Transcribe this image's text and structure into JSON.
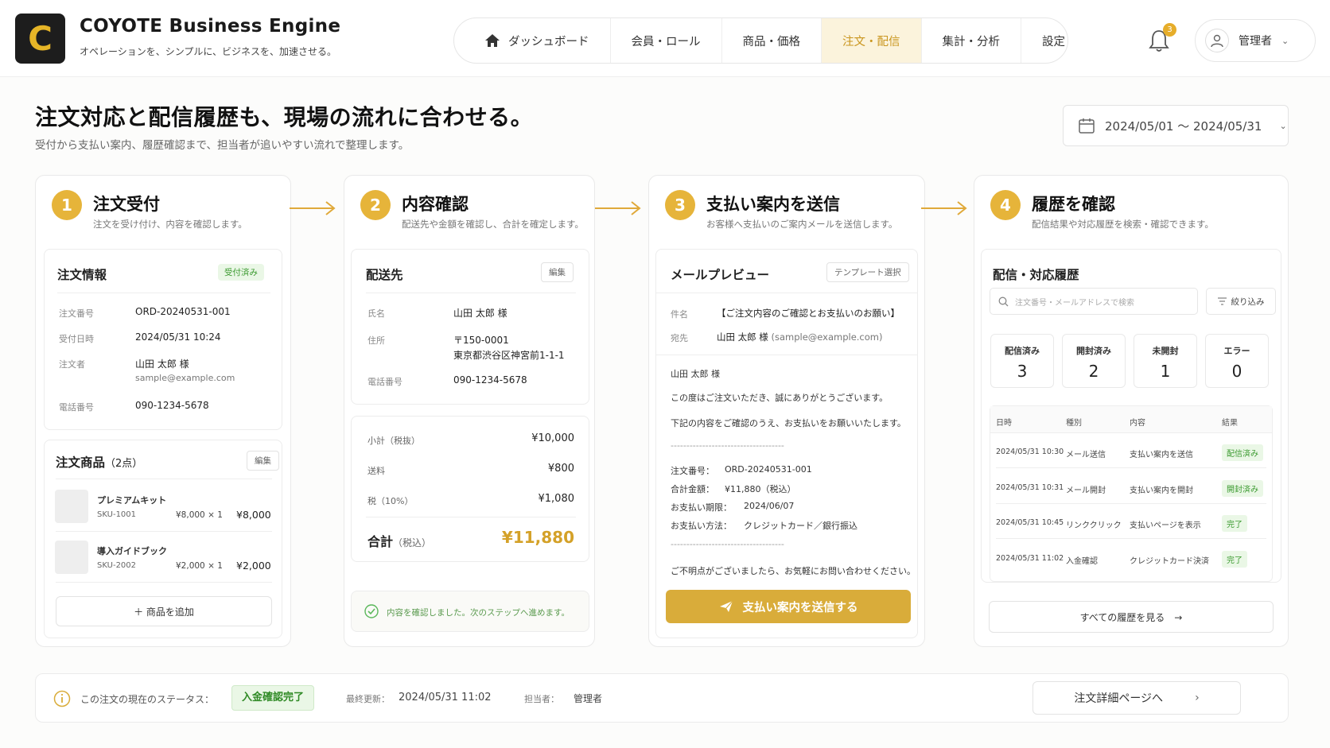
{
  "app": {
    "logo_letter": "C",
    "title": "COYOTE Business Engine",
    "tagline": "オペレーションを、シンプルに、ビジネスを、加速させる。"
  },
  "nav": [
    {
      "label": "ダッシュボード",
      "icon": "home-icon"
    },
    {
      "label": "会員・ロール"
    },
    {
      "label": "商品・価格"
    },
    {
      "label": "注文・配信",
      "active": true
    },
    {
      "label": "集計・分析"
    },
    {
      "label": "設定"
    }
  ],
  "notifications": {
    "count": "3"
  },
  "user": {
    "name": "管理者"
  },
  "page": {
    "title": "注文対応と配信履歴も、現場の流れに合わせる。",
    "subtitle": "受付から支払い案内、履歴確認まで、担当者が追いやすい流れで整理します。",
    "date_range": "2024/05/01 〜 2024/05/31"
  },
  "steps": [
    {
      "num": "1",
      "title": "注文受付",
      "desc": "注文を受け付け、内容を確認します。"
    },
    {
      "num": "2",
      "title": "内容確認",
      "desc": "配送先や金額を確認し、合計を確定します。"
    },
    {
      "num": "3",
      "title": "支払い案内を送信",
      "desc": "お客様へ支払いのご案内メールを送信します。"
    },
    {
      "num": "4",
      "title": "履歴を確認",
      "desc": "配信結果や対応履歴を検索・確認できます。"
    }
  ],
  "order_info": {
    "title": "注文情報",
    "status": "受付済み",
    "order_no_label": "注文番号",
    "order_no": "ORD-20240531-001",
    "received_label": "受付日時",
    "received": "2024/05/31 10:24",
    "customer_label": "注文者",
    "customer_name": "山田 太郎 様",
    "customer_email": "sample@example.com",
    "phone_label": "電話番号",
    "phone": "090-1234-5678"
  },
  "order_items": {
    "title": "注文商品",
    "count": "（2点）",
    "edit": "編集",
    "items": [
      {
        "name": "プレミアムキット",
        "sku": "SKU-1001",
        "unit": "¥8,000 × 1",
        "total": "¥8,000"
      },
      {
        "name": "導入ガイドブック",
        "sku": "SKU-2002",
        "unit": "¥2,000 × 1",
        "total": "¥2,000"
      }
    ],
    "add": "＋ 商品を追加"
  },
  "shipping": {
    "title": "配送先",
    "edit": "編集",
    "name_label": "氏名",
    "name": "山田 太郎 様",
    "address_label": "住所",
    "zip": "〒150-0001",
    "address": "東京都渋谷区神宮前1-1-1",
    "phone_label": "電話番号",
    "phone": "090-1234-5678"
  },
  "totals": {
    "subtotal_label": "小計（税抜）",
    "subtotal": "¥10,000",
    "shipping_label": "送料",
    "shipping": "¥800",
    "tax_label": "税（10%）",
    "tax": "¥1,080",
    "total_label": "合計",
    "total_note": "（税込）",
    "total": "¥11,880"
  },
  "confirm_note": "内容を確認しました。次のステップへ進めます。",
  "mail": {
    "title": "メールプレビュー",
    "template": "テンプレート選択",
    "subject_label": "件名",
    "subject": "【ご注文内容のご確認とお支払いのお願い】",
    "to_label": "宛先",
    "to_name": "山田 太郎 様",
    "to_email": "(sample@example.com)",
    "greeting": "山田 太郎 様",
    "line1": "この度はご注文いただき、誠にありがとうございます。",
    "line2": "下記の内容をご確認のうえ、お支払いをお願いいたします。",
    "sep": "------------------------------------",
    "order_label": "注文番号：",
    "order_no": "ORD-20240531-001",
    "amount_label": "合計金額：",
    "amount": "¥11,880（税込）",
    "due_label": "お支払い期限：",
    "due": "2024/06/07",
    "method_label": "お支払い方法：",
    "method": "クレジットカード／銀行振込",
    "closing": "ご不明点がございましたら、お気軽にお問い合わせください。",
    "send": "支払い案内を送信する"
  },
  "history": {
    "title": "配信・対応履歴",
    "search_placeholder": "注文番号・メールアドレスで検索",
    "filter": "絞り込み",
    "stats": [
      {
        "label": "配信済み",
        "value": "3"
      },
      {
        "label": "開封済み",
        "value": "2"
      },
      {
        "label": "未開封",
        "value": "1"
      },
      {
        "label": "エラー",
        "value": "0"
      }
    ],
    "headers": [
      "日時",
      "種別",
      "内容",
      "結果"
    ],
    "rows": [
      {
        "time": "2024/05/31 10:30",
        "type": "メール送信",
        "content": "支払い案内を送信",
        "result": "配信済み"
      },
      {
        "time": "2024/05/31 10:31",
        "type": "メール開封",
        "content": "支払い案内を開封",
        "result": "開封済み"
      },
      {
        "time": "2024/05/31 10:45",
        "type": "リンククリック",
        "content": "支払いページを表示",
        "result": "完了"
      },
      {
        "time": "2024/05/31 11:02",
        "type": "入金確認",
        "content": "クレジットカード決済",
        "result": "完了"
      }
    ],
    "all": "すべての履歴を見る　→"
  },
  "footer": {
    "status_label": "この注文の現在のステータス：",
    "status": "入金確認完了",
    "updated_label": "最終更新：",
    "updated": "2024/05/31 11:02",
    "owner_label": "担当者：",
    "owner": "管理者",
    "detail": "注文詳細ページへ"
  },
  "colors": {
    "accent": "#e6b43a",
    "success": "#3a9a2f"
  }
}
